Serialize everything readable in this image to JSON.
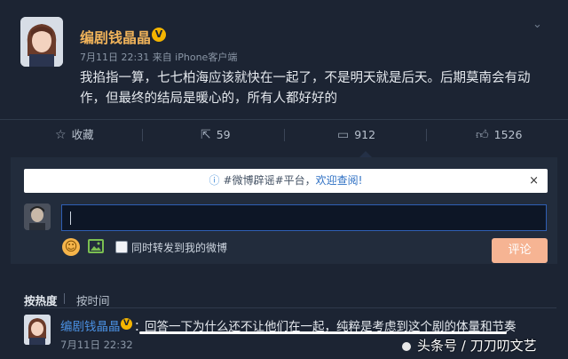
{
  "post": {
    "author": "编剧钱晶晶",
    "verified_badge": "V",
    "meta": "7月11日 22:31 来自 iPhone客户端",
    "content": "我掐指一算，七七柏海应该就快在一起了，不是明天就是后天。后期莫南会有动作，但最终的结局是暖心的，所有人都好好的",
    "more_icon": "chevron-down-icon"
  },
  "actions": {
    "favorite": {
      "icon": "star-icon",
      "label": "收藏"
    },
    "repost": {
      "icon": "share-icon",
      "label": "59"
    },
    "comment": {
      "icon": "comment-icon",
      "label": "912"
    },
    "like": {
      "icon": "thumb-up-icon",
      "label": "1526"
    }
  },
  "notice": {
    "prefix": "#微博辟谣#平台，",
    "link": "欢迎查阅!",
    "close": "×"
  },
  "comment_box": {
    "input_value": "",
    "checkbox_label": "同时转发到我的微博",
    "submit_label": "评论"
  },
  "sort": {
    "hot": "按热度",
    "time": "按时间"
  },
  "comments": [
    {
      "author": "编剧钱晶晶",
      "badge": "V",
      "colon": "：",
      "text": "回答一下为什么还不让他们在一起，纯粹是考虑到这个剧的体量和节奏",
      "time": "7月11日 22:32"
    }
  ],
  "watermark": "头条号 / 刀刀叨文艺",
  "colors": {
    "background": "#1c2433",
    "author": "#f0b35a",
    "link": "#4a90e2",
    "submit": "#f6b493"
  }
}
